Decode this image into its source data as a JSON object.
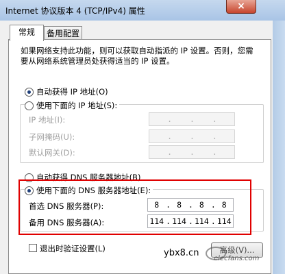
{
  "window": {
    "title": "Internet 协议版本 4 (TCP/IPv4) 属性",
    "close_glyph": "×"
  },
  "tabs": [
    {
      "label": "常规",
      "active": true
    },
    {
      "label": "备用配置",
      "active": false
    }
  ],
  "description": "如果网络支持此功能，则可以获取自动指派的 IP 设置。否则，您需要从网络系统管理员处获得适当的 IP 设置。",
  "ip_section": {
    "auto_label": "自动获得 IP 地址(O)",
    "auto_checked": true,
    "manual_label": "使用下面的 IP 地址(S):",
    "manual_checked": false,
    "fields": [
      {
        "label": "IP 地址(I):",
        "value": [
          ".",
          ".",
          "."
        ]
      },
      {
        "label": "子网掩码(U):",
        "value": [
          ".",
          ".",
          "."
        ]
      },
      {
        "label": "默认网关(D):",
        "value": [
          ".",
          ".",
          "."
        ]
      }
    ]
  },
  "dns_section": {
    "auto_label": "自动获得 DNS 服务器地址(B)",
    "auto_checked": false,
    "manual_label": "使用下面的 DNS 服务器地址(E):",
    "manual_checked": true,
    "preferred": {
      "label": "首选 DNS 服务器(P):",
      "octets": [
        "8",
        "8",
        "8",
        "8"
      ]
    },
    "alternate": {
      "label": "备用 DNS 服务器(A):",
      "octets": [
        "114",
        "114",
        "114",
        "114"
      ]
    }
  },
  "validate_on_exit": {
    "label": "退出时验证设置(L)",
    "checked": false
  },
  "advanced_button": "高级(V)...",
  "watermark": {
    "site": "ybx8.cn",
    "brand": "elecfans.com"
  },
  "colors": {
    "highlight": "#e00000",
    "radio_dot": "#1f3f7a"
  }
}
